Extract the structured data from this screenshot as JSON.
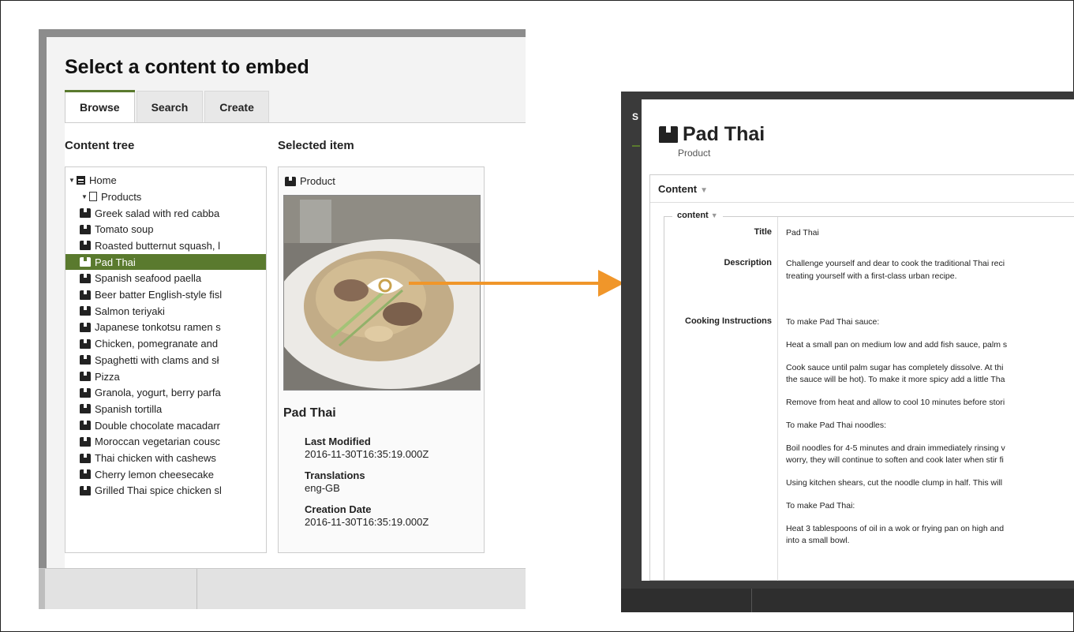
{
  "left_dialog": {
    "title": "Select a content to embed",
    "tabs": [
      "Browse",
      "Search",
      "Create"
    ],
    "content_tree_heading": "Content tree",
    "selected_item_heading": "Selected item",
    "tree": {
      "root": "Home",
      "folder": "Products",
      "items": [
        "Greek salad with red cabba",
        "Tomato soup",
        "Roasted butternut squash, l",
        "Pad Thai",
        "Spanish seafood paella",
        "Beer batter English-style fisl",
        "Salmon teriyaki",
        "Japanese tonkotsu ramen s",
        "Chicken, pomegranate and",
        "Spaghetti with clams and sł",
        "Pizza",
        "Granola, yogurt, berry parfa",
        "Spanish tortilla",
        "Double chocolate macadarr",
        "Moroccan vegetarian cousc",
        "Thai chicken with cashews",
        "Cherry lemon cheesecake",
        "Grilled Thai spice chicken sl"
      ],
      "selected_index": 3
    },
    "selected_item": {
      "type": "Product",
      "name": "Pad Thai",
      "last_modified_label": "Last Modified",
      "last_modified": "2016-11-30T16:35:19.000Z",
      "translations_label": "Translations",
      "translations": "eng-GB",
      "creation_date_label": "Creation Date",
      "creation_date": "2016-11-30T16:35:19.000Z"
    }
  },
  "right_dialog": {
    "edge_letter": "S",
    "title": "Pad Thai",
    "subtitle": "Product",
    "content_tab": "Content",
    "fieldset_legend": "content",
    "fields": {
      "title_label": "Title",
      "title_value": "Pad Thai",
      "description_label": "Description",
      "description_lines": [
        "Challenge yourself and dear to cook the traditional Thai reci",
        "treating yourself with a first-class urban recipe."
      ],
      "cooking_label": "Cooking Instructions",
      "cooking_lines": [
        [
          "To make Pad Thai sauce:"
        ],
        [
          "Heat a small pan on medium low and add fish sauce, palm s"
        ],
        [
          "Cook sauce until palm sugar has completely dissolve. At thi",
          "the sauce will be hot). To make it more spicy add a little Tha"
        ],
        [
          "Remove from heat and allow to cool 10 minutes before stori"
        ],
        [
          "To make Pad Thai noodles:"
        ],
        [
          "Boil noodles for 4-5 minutes and drain immediately rinsing v",
          "worry, they will continue to soften and cook later when stir fi"
        ],
        [
          "Using kitchen shears, cut the noodle clump in half. This will"
        ],
        [
          "To make Pad Thai:"
        ],
        [
          "Heat 3 tablespoons of oil in a wok or frying pan on high and",
          "into a small bowl."
        ]
      ]
    }
  },
  "colors": {
    "accent_green": "#5a7a2e",
    "arrow_orange": "#f0962a"
  },
  "icons": [
    "box-icon",
    "home-icon",
    "folder-icon",
    "eye-icon",
    "arrow-icon"
  ]
}
